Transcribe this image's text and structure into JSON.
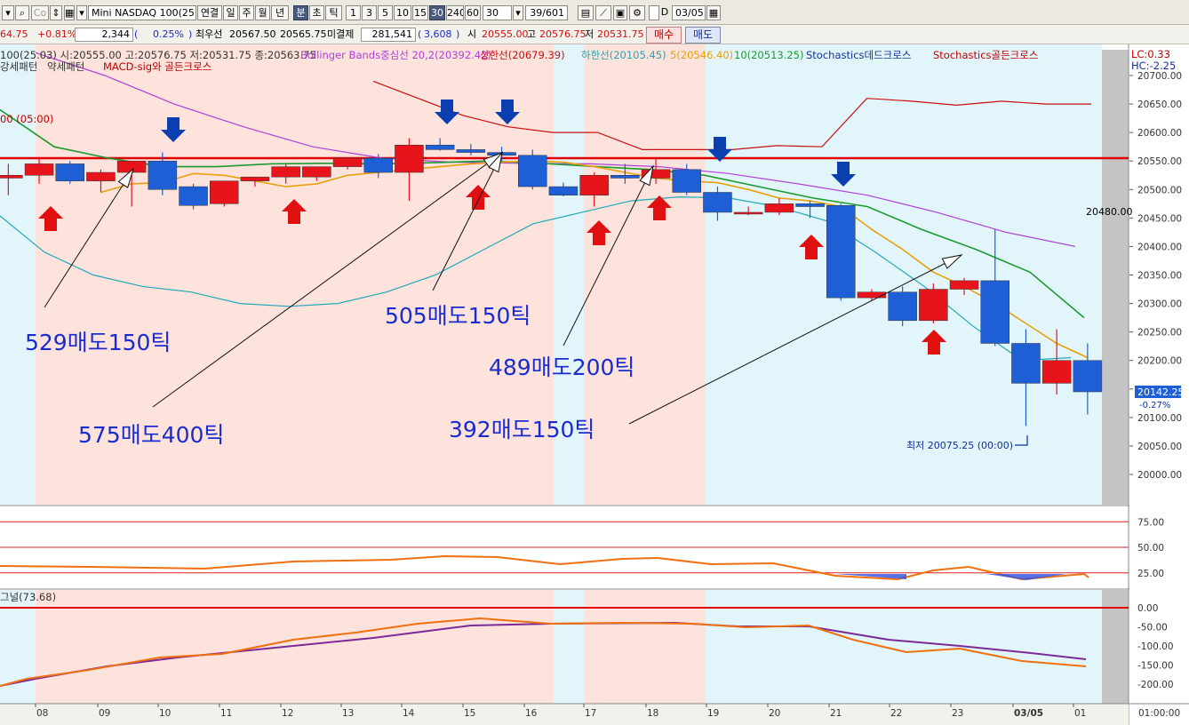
{
  "toolbar": {
    "symbol": "Mini NASDAQ 100(25.0",
    "buttons": [
      "연결",
      "일",
      "주",
      "월",
      "년",
      "분",
      "초",
      "틱",
      "1",
      "3",
      "5",
      "10",
      "15",
      "30",
      "240",
      "60"
    ],
    "selected_button": "분",
    "interval_selected": "30",
    "interval_value": "30",
    "count": "39/601",
    "checkbox_label": "D",
    "date": "03/05"
  },
  "infobar": {
    "change": "64.75",
    "change_pct": "+0.81%",
    "volume": "2,344",
    "volume_pct": "0.25%",
    "best_bid_label": "최우선",
    "best_bid": "20567.50",
    "best_ask": "20565.75",
    "open_interest_label": "미결제",
    "open_interest": "281,541",
    "oi_change": "3,608",
    "open_label": "시",
    "open": "20555.00",
    "high_label": "고",
    "high": "20576.75",
    "low_label": "저",
    "low": "20531.75",
    "buy_label": "매수",
    "sell_label": "매도"
  },
  "legend": {
    "ohlc": "100(25.03) 시:20555.00 고:20576.75 저:20531.75 종:20563.75",
    "bollinger_mid": "Bollinger Bands중심선 20,2(20392.42)",
    "bollinger_upper": "상한선(20679.39)",
    "bollinger_lower": "하한선(20105.45)",
    "ma5": "5(20546.40)",
    "ma10": "10(20513.25)",
    "stoch_dead": "Stochastics데드크로스",
    "stoch_golden": "Stochastics골든크로스",
    "line2_a": "강세패턴",
    "line2_b": "약세패턴",
    "line2_c": "MACD-sig와 골든크로스",
    "line3": "00 (05:00)",
    "lc": "LC:0.33",
    "hc": "HC:-2.25",
    "macd_label": "그널(73.68)"
  },
  "annotations": {
    "a1": "529매도150틱",
    "a2": "575매도400틱",
    "a3": "505매도150틱",
    "a4": "489매도200틱",
    "a5": "392매도150틱",
    "level_label": "20480.00",
    "current_price": "20142.25",
    "current_pct": "-0.27%",
    "low_marker": "최저 20075.25 (00:00)"
  },
  "colors": {
    "up": "#e8141c",
    "down": "#1f5fd6",
    "ma5": "#e8a00c",
    "ma10": "#1c9a30",
    "bb_mid": "#b040d8",
    "bb_upper": "#c80f0f",
    "bb_lower": "#20a8b8",
    "annotation": "#1a2ccf",
    "shade_pink": "#fde3dc",
    "shade_blue": "#e2f5fb"
  },
  "chart_data": {
    "type": "candlestick",
    "y_axis": {
      "min": 20000,
      "max": 20700,
      "ticks": [
        "20700.00",
        "20650.00",
        "20600.00",
        "20550.00",
        "20500.00",
        "20450.00",
        "20400.00",
        "20350.00",
        "20300.00",
        "20250.00",
        "20200.00",
        "20150.00",
        "20100.00",
        "20050.00",
        "20000.00"
      ]
    },
    "x_labels": [
      "08",
      "09",
      "10",
      "11",
      "12",
      "13",
      "14",
      "15",
      "16",
      "17",
      "18",
      "19",
      "20",
      "21",
      "22",
      "23",
      "03/05",
      "01"
    ],
    "time_axis_label": "01:00:00",
    "candles": [
      {
        "o": 20520,
        "h": 20545,
        "l": 20490,
        "c": 20525
      },
      {
        "o": 20525,
        "h": 20555,
        "l": 20510,
        "c": 20545
      },
      {
        "o": 20545,
        "h": 20550,
        "l": 20510,
        "c": 20515
      },
      {
        "o": 20515,
        "h": 20535,
        "l": 20495,
        "c": 20530
      },
      {
        "o": 20530,
        "h": 20550,
        "l": 20470,
        "c": 20550
      },
      {
        "o": 20550,
        "h": 20565,
        "l": 20490,
        "c": 20500
      },
      {
        "o": 20505,
        "h": 20510,
        "l": 20465,
        "c": 20472
      },
      {
        "o": 20475,
        "h": 20515,
        "l": 20470,
        "c": 20515
      },
      {
        "o": 20515,
        "h": 20522,
        "l": 20505,
        "c": 20522
      },
      {
        "o": 20522,
        "h": 20545,
        "l": 20510,
        "c": 20540
      },
      {
        "o": 20522,
        "h": 20540,
        "l": 20515,
        "c": 20540
      },
      {
        "o": 20540,
        "h": 20555,
        "l": 20535,
        "c": 20555
      },
      {
        "o": 20555,
        "h": 20562,
        "l": 20520,
        "c": 20530
      },
      {
        "o": 20530,
        "h": 20590,
        "l": 20480,
        "c": 20578
      },
      {
        "o": 20578,
        "h": 20590,
        "l": 20568,
        "c": 20570
      },
      {
        "o": 20570,
        "h": 20580,
        "l": 20560,
        "c": 20565
      },
      {
        "o": 20565,
        "h": 20575,
        "l": 20550,
        "c": 20560
      },
      {
        "o": 20560,
        "h": 20570,
        "l": 20500,
        "c": 20505
      },
      {
        "o": 20505,
        "h": 20512,
        "l": 20488,
        "c": 20490
      },
      {
        "o": 20490,
        "h": 20530,
        "l": 20470,
        "c": 20525
      },
      {
        "o": 20525,
        "h": 20545,
        "l": 20510,
        "c": 20520
      },
      {
        "o": 20520,
        "h": 20555,
        "l": 20510,
        "c": 20535
      },
      {
        "o": 20535,
        "h": 20545,
        "l": 20490,
        "c": 20495
      },
      {
        "o": 20495,
        "h": 20505,
        "l": 20445,
        "c": 20460
      },
      {
        "o": 20460,
        "h": 20470,
        "l": 20455,
        "c": 20460
      },
      {
        "o": 20460,
        "h": 20485,
        "l": 20455,
        "c": 20475
      },
      {
        "o": 20475,
        "h": 20480,
        "l": 20450,
        "c": 20470
      },
      {
        "o": 20472,
        "h": 20475,
        "l": 20305,
        "c": 20310
      },
      {
        "o": 20310,
        "h": 20325,
        "l": 20305,
        "c": 20320
      },
      {
        "o": 20320,
        "h": 20330,
        "l": 20260,
        "c": 20270
      },
      {
        "o": 20270,
        "h": 20335,
        "l": 20265,
        "c": 20325
      },
      {
        "o": 20325,
        "h": 20345,
        "l": 20315,
        "c": 20340
      },
      {
        "o": 20340,
        "h": 20430,
        "l": 20225,
        "c": 20230
      },
      {
        "o": 20230,
        "h": 20255,
        "l": 20085,
        "c": 20160
      },
      {
        "o": 20160,
        "h": 20255,
        "l": 20140,
        "c": 20200
      },
      {
        "o": 20200,
        "h": 20230,
        "l": 20105,
        "c": 20145
      }
    ],
    "ma5": [
      20495,
      20510,
      20512,
      20528,
      20525,
      20515,
      20505,
      20510,
      20525,
      20530,
      20535,
      20540,
      20545,
      20548,
      20550,
      20548,
      20540,
      20530,
      20520,
      20515,
      20512,
      20500,
      20485,
      20480,
      20470,
      20430,
      20395,
      20355,
      20330,
      20300,
      20265,
      20230,
      20205
    ],
    "ma10": [
      20640,
      20575,
      20555,
      20540,
      20540,
      20545,
      20546,
      20545,
      20547,
      20550,
      20546,
      20540,
      20535,
      20525,
      20505,
      20485,
      20470,
      20430,
      20395,
      20355,
      20275
    ],
    "bb_mid": [
      20740,
      20700,
      20650,
      20610,
      20575,
      20555,
      20548,
      20546,
      20545,
      20540,
      20528,
      20510,
      20490,
      20460,
      20425,
      20400
    ],
    "bb_upper": [
      20690,
      20660,
      20630,
      20610,
      20600,
      20600,
      20570,
      20570,
      20570,
      20577,
      20575,
      20660,
      20655,
      20648,
      20655,
      20650,
      20650
    ],
    "bb_lower": [
      20460,
      20390,
      20350,
      20330,
      20320,
      20300,
      20295,
      20300,
      20320,
      20350,
      20395,
      20440,
      20460,
      20480,
      20487,
      20485,
      20470,
      20445,
      20390,
      20330,
      20260,
      20200,
      20205
    ],
    "oscillator": {
      "levels": [
        75,
        50,
        25
      ]
    },
    "macd": {
      "ticks": [
        "0.00",
        "-50.00",
        "-100.00",
        "-150.00",
        "-200.00"
      ]
    }
  }
}
